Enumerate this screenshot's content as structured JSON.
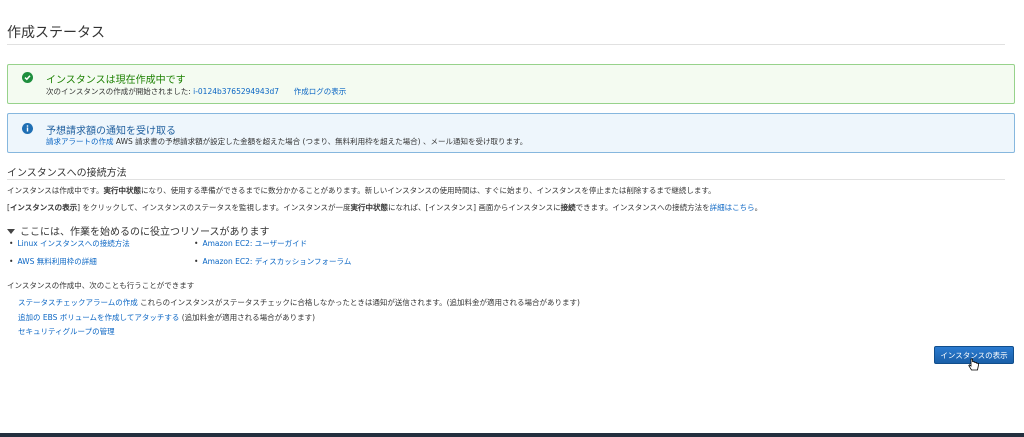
{
  "page": {
    "title": "作成ステータス"
  },
  "success_alert": {
    "heading": "インスタンスは現在作成中です",
    "line_prefix": "次のインスタンスの作成が開始されました: ",
    "instance_id": "i-0124b3765294943d7",
    "log_link": "作成ログの表示",
    "color": "#1d8102"
  },
  "info_alert": {
    "heading": "予想請求額の通知を受け取る",
    "link": "請求アラートの作成",
    "text": " AWS 請求書の予想請求額が設定した金額を超えた場合 (つまり、無料利用枠を超えた場合) 、メール通知を受け取ります。",
    "color": "#1f6fb4"
  },
  "connect": {
    "title": "インスタンスへの接続方法",
    "p1_a": "インスタンスは作成中です。",
    "p1_b": "実行中状態",
    "p1_c": "になり、使用する準備ができるまでに数分かかることがあります。新しいインスタンスの使用時間は、すぐに始まり、インスタンスを停止または削除するまで継続します。",
    "p2_a": "[",
    "p2_b": "インスタンスの表示",
    "p2_c": "] をクリックして、インスタンスのステータスを監視します。インスタンスが一度",
    "p2_d": "実行中状態",
    "p2_e": "になれば、[インスタンス] 画面からインスタンスに",
    "p2_f": "接続",
    "p2_g": "できます。インスタンスへの接続方法を",
    "p2_link": "詳細はこちら",
    "p2_end": "。"
  },
  "resources": {
    "title": "ここには、作業を始めるのに役立つリソースがあります",
    "col1": [
      "Linux インスタンスへの接続方法",
      "AWS 無料利用枠の詳細"
    ],
    "col2": [
      "Amazon EC2: ユーザーガイド",
      "Amazon EC2: ディスカッションフォーラム"
    ]
  },
  "also": {
    "title": "インスタンスの作成中、次のことも行うことができます",
    "item1_link": "ステータスチェックアラームの作成",
    "item1_text": " これらのインスタンスがステータスチェックに合格しなかったときは通知が送信されます。(追加料金が適用される場合があります)",
    "item2_link": "追加の EBS ボリュームを作成してアタッチする",
    "item2_text": " (追加料金が適用される場合があります)",
    "item3_link": "セキュリティグループの管理"
  },
  "buttons": {
    "view_instances": "インスタンスの表示"
  },
  "icons": {
    "success": "check-circle-icon",
    "info": "info-circle-icon",
    "toggle": "caret-down-icon",
    "cursor": "hand-pointer-icon"
  },
  "colors": {
    "link": "#0b66c4",
    "button": "#1f6fb4"
  }
}
